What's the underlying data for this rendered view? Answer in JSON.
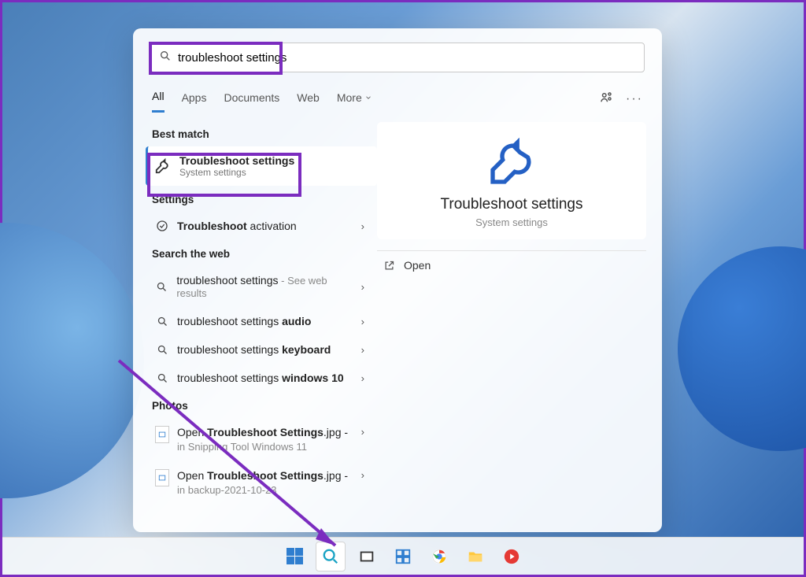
{
  "search": {
    "value": "troubleshoot settings"
  },
  "tabs": {
    "all": "All",
    "apps": "Apps",
    "documents": "Documents",
    "web": "Web",
    "more": "More"
  },
  "best_match": {
    "header": "Best match",
    "title": "Troubleshoot settings",
    "subtitle": "System settings"
  },
  "settings": {
    "header": "Settings",
    "item1_bold": "Troubleshoot",
    "item1_rest": " activation"
  },
  "web": {
    "header": "Search the web",
    "item1_text": "troubleshoot settings",
    "item1_sub": " - See web results",
    "item2_pre": "troubleshoot settings ",
    "item2_bold": "audio",
    "item3_pre": "troubleshoot settings ",
    "item3_bold": "keyboard",
    "item4_pre": "troubleshoot settings ",
    "item4_bold": "windows 10"
  },
  "photos": {
    "header": "Photos",
    "item1_pre": "Open ",
    "item1_bold": "Troubleshoot Settings",
    "item1_post": ".jpg -",
    "item1_sub": "in Snipping Tool Windows 11",
    "item2_pre": "Open ",
    "item2_bold": "Troubleshoot Settings",
    "item2_post": ".jpg -",
    "item2_sub": "in backup-2021-10-23"
  },
  "preview": {
    "title": "Troubleshoot settings",
    "subtitle": "System settings",
    "open": "Open"
  }
}
